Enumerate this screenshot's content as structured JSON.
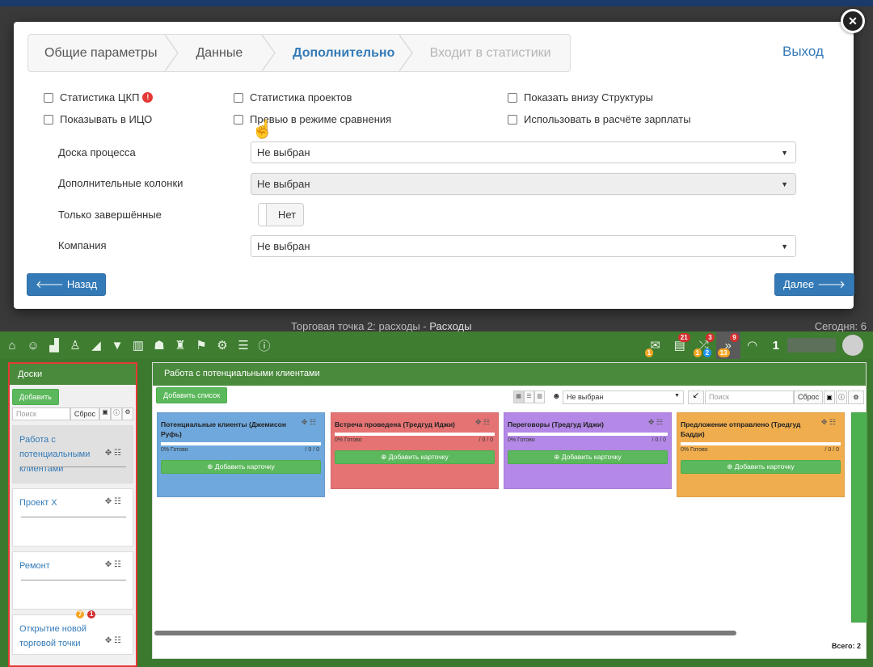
{
  "background": {
    "subrow_left": "Торговая точка 2: расходы -",
    "subrow_bold": "Расходы",
    "today": "Сегодня: 6"
  },
  "toolbar": {
    "icons": [
      "home-icon",
      "users-icon",
      "factory-icon",
      "org-chart-icon",
      "chart-icon",
      "filter-icon",
      "bar-chart-icon",
      "hat-icon",
      "moneybag-icon",
      "flag-icon",
      "gear-icon",
      "list-icon",
      "info-icon"
    ],
    "mail_badge": "1",
    "tasks_badge": "21",
    "shuffle_badge_top": "3",
    "shuffle_badge_a": "1",
    "shuffle_badge_b": "2",
    "forward_badge_top": "9",
    "forward_badge_bottom": "13",
    "counter": "1"
  },
  "boards": {
    "title": "Доски",
    "add_label": "Добавить",
    "search_placeholder": "Поиск",
    "reset_label": "Сброс",
    "items": [
      {
        "label": "Работа с потенциальными клиентами"
      },
      {
        "label": "Проект Х"
      },
      {
        "label": "Ремонт"
      },
      {
        "label": "Открытие новой торговой точки",
        "badge_orange": "7",
        "badge_red": "1"
      }
    ]
  },
  "main": {
    "title": "Работа с потенциальными клиентами",
    "add_list_label": "Добавить список",
    "responsible_value": "Не выбран",
    "search_placeholder": "Поиск",
    "reset_label": "Сброс",
    "total": "Всего: 2",
    "columns": [
      {
        "title": "Потенциальные клиенты (Джемисон Руфь)",
        "ready": "0% Готово",
        "count": "/ 0 / 0",
        "add": "Добавить карточку",
        "color": "#6fa8dc"
      },
      {
        "title": "Встреча проведена (Тредгуд Иджи)",
        "ready": "0% Готово",
        "count": "/ 0 / 0",
        "add": "Добавить карточку",
        "color": "#e57373"
      },
      {
        "title": "Переговоры (Тредгуд Иджи)",
        "ready": "0% Готово",
        "count": "/ 0 / 0",
        "add": "Добавить карточку",
        "color": "#b388e6"
      },
      {
        "title": "Предложение отправлено (Тредгуд Бадди)",
        "ready": "0% Готово",
        "count": "/ 0 / 0",
        "add": "Добавить карточку",
        "color": "#f0ad4e"
      }
    ]
  },
  "modal": {
    "steps": [
      "Общие параметры",
      "Данные",
      "Дополнительно",
      "Входит в статистики"
    ],
    "exit_label": "Выход",
    "checkboxes": {
      "stat_ckp": "Статистика ЦКП",
      "show_ico": "Показывать в ИЦО",
      "stat_projects": "Статистика проектов",
      "preview_compare": "Превью в режиме сравнения",
      "show_structure": "Показать внизу Структуры",
      "use_salary": "Использовать в расчёте зарплаты"
    },
    "fields": {
      "process_board_label": "Доска процесса",
      "process_board_value": "Не выбран",
      "extra_columns_label": "Дополнительные колонки",
      "extra_columns_value": "Не выбран",
      "only_completed_label": "Только завершённые",
      "only_completed_value": "Нет",
      "company_label": "Компания",
      "company_value": "Не выбран"
    },
    "back_label": "Назад",
    "next_label": "Далее"
  }
}
